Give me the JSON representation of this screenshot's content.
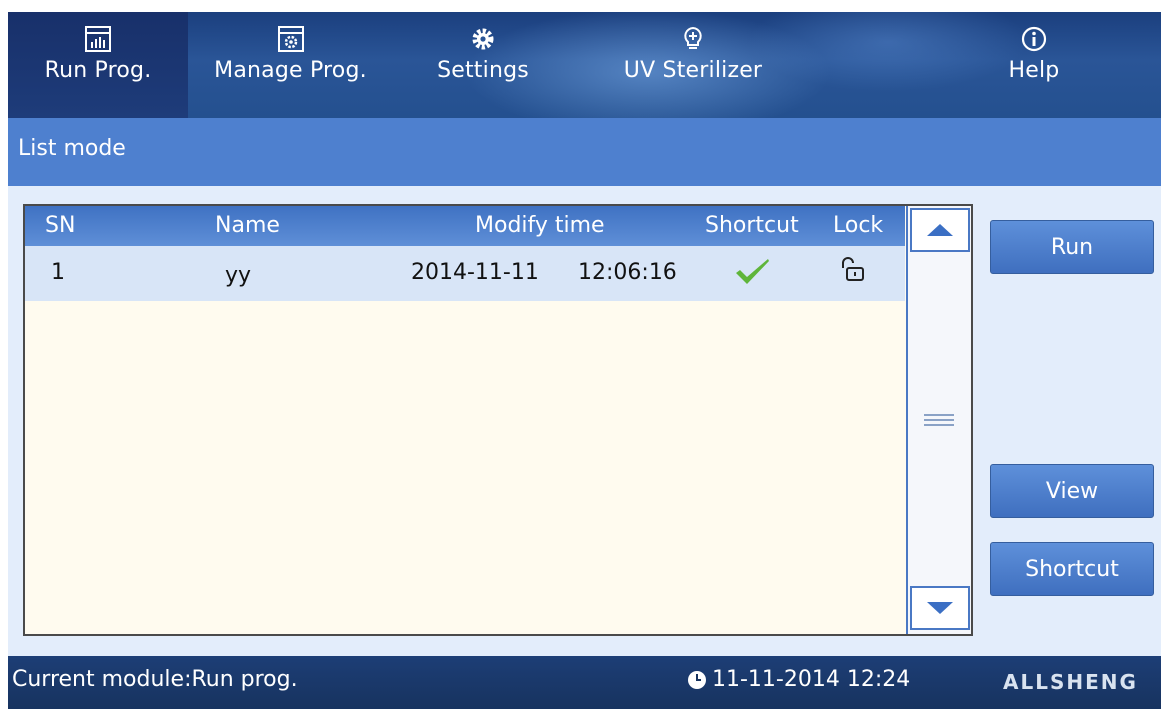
{
  "tabs": [
    {
      "label": "Run Prog.",
      "icon": "chart-window-icon",
      "active": true
    },
    {
      "label": "Manage Prog.",
      "icon": "gear-window-icon",
      "active": false
    },
    {
      "label": "Settings",
      "icon": "gear-icon",
      "active": false
    },
    {
      "label": "UV Sterilizer",
      "icon": "bulb-icon",
      "active": false
    },
    {
      "label": "Help",
      "icon": "info-icon",
      "active": false
    }
  ],
  "page": {
    "title": "List mode"
  },
  "list": {
    "columns": {
      "sn": "SN",
      "name": "Name",
      "modify_time": "Modify time",
      "shortcut": "Shortcut",
      "lock": "Lock"
    },
    "rows": [
      {
        "sn": "1",
        "name": "yy",
        "date": "2014-11-11",
        "time": "12:06:16",
        "shortcut": true,
        "locked": false
      }
    ]
  },
  "buttons": {
    "run": "Run",
    "view": "View",
    "shortcut": "Shortcut"
  },
  "status": {
    "module": "Current module:Run prog.",
    "datetime": "11-11-2014 12:24",
    "brand": "ALLSHENG"
  },
  "colors": {
    "tab_bar": "#24508f",
    "title_strip": "#4e80cf",
    "list_header": "#4a7bcb",
    "selected_row": "#d8e5f7",
    "check": "#5fb53a"
  }
}
